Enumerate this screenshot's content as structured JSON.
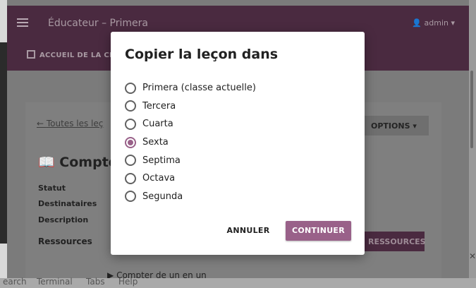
{
  "background": {
    "app_title": "Éducateur – Primera",
    "user_name": "admin",
    "nav_home": "ACCUEIL DE LA CL",
    "back_link": "Toutes les leç",
    "options_button": "OPTIONS",
    "lesson_title": "Compte",
    "labels": [
      "Statut",
      "Destinataires",
      "Description"
    ],
    "resources_heading": "Ressources",
    "resources_button": "RESSOURCES",
    "resource_row": "Compter de un en un"
  },
  "terminal_menu": [
    "earch",
    "Terminal",
    "Tabs",
    "Help"
  ],
  "modal": {
    "title": "Copier la leçon dans",
    "options": [
      {
        "label": "Primera (classe actuelle)",
        "checked": false
      },
      {
        "label": "Tercera",
        "checked": false
      },
      {
        "label": "Cuarta",
        "checked": false
      },
      {
        "label": "Sexta",
        "checked": true
      },
      {
        "label": "Septima",
        "checked": false
      },
      {
        "label": "Octava",
        "checked": false
      },
      {
        "label": "Segunda",
        "checked": false
      }
    ],
    "cancel_label": "ANNULER",
    "continue_label": "CONTINUER"
  },
  "colors": {
    "accent": "#996189",
    "appbar": "#4a2a40"
  }
}
